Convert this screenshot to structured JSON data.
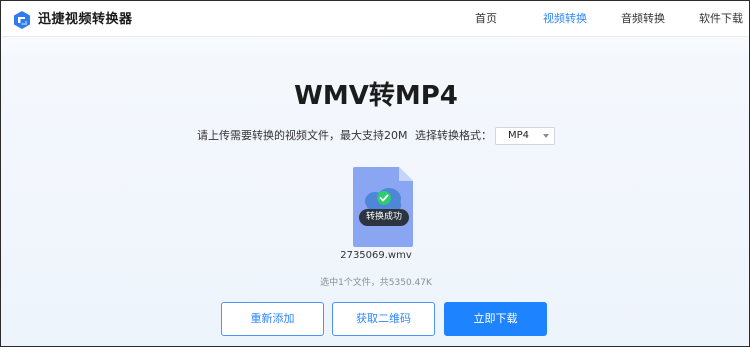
{
  "header": {
    "brand": "迅捷视频转换器",
    "nav": [
      {
        "label": "首页",
        "active": false
      },
      {
        "label": "视频转换",
        "active": true
      },
      {
        "label": "音频转换",
        "active": false
      },
      {
        "label": "软件下载",
        "active": false
      }
    ]
  },
  "main": {
    "title": "WMV转MP4",
    "instruction": "请上传需要转换的视频文件，最大支持20M",
    "format_label": "选择转换格式：",
    "format_selected": "MP4",
    "file": {
      "name": "2735069.wmv",
      "status": "转换成功",
      "icon": "cloud-check-icon"
    },
    "summary": "选中1个文件，共5350.47K"
  },
  "buttons": {
    "readd": "重新添加",
    "qrcode": "获取二维码",
    "download": "立即下载"
  },
  "colors": {
    "accent": "#2d86ff",
    "primary_button": "#1d83ff",
    "file_card": "#8aa6f2",
    "badge": "#2c3440",
    "success": "#2ecc71"
  }
}
